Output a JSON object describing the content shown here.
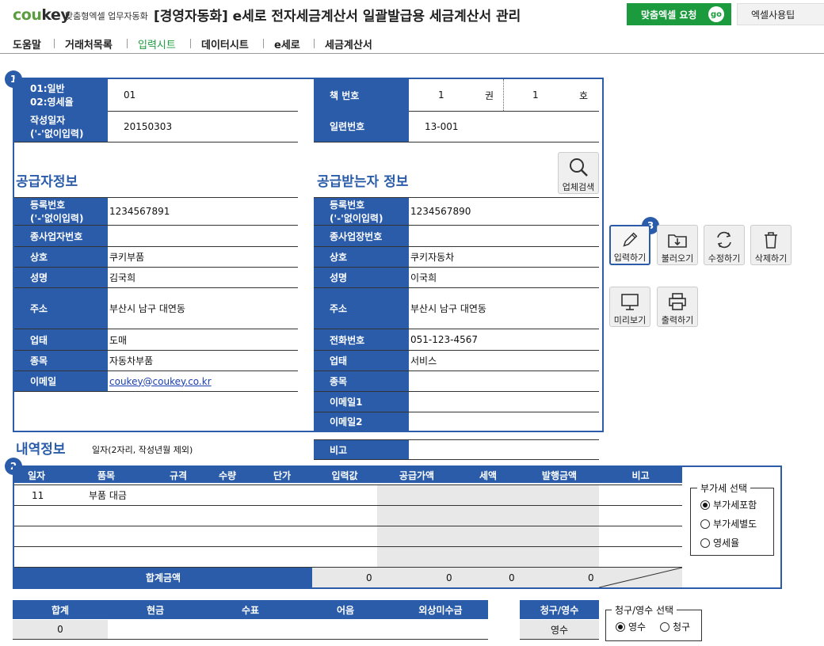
{
  "header": {
    "logo_part1": "cou",
    "logo_part2": "key",
    "logo_subtitle": "맞춤형엑셀 업무자동화",
    "title": "[경영자동화] e세로 전자세금계산서 일괄발급용 세금계산서 관리",
    "request_button": "맞춤엑셀 요청",
    "go_label": "go",
    "tips_button": "엑셀사용팁"
  },
  "menu": [
    "도움말",
    "거래처목록",
    "입력시트",
    "데이터시트",
    "e세로",
    "세금계산서"
  ],
  "menu_active": "입력시트",
  "badges": {
    "one": "1",
    "two": "2",
    "three": "3"
  },
  "top_info": {
    "type_label_1": "01:일반",
    "type_label_2": "02:영세율",
    "type_value": "01",
    "date_label_1": "작성일자",
    "date_label_2": "('-'없이입력)",
    "date_value": "20150303",
    "book_label": "책 번호",
    "book_vol": "1",
    "book_vol_unit": "권",
    "book_no": "1",
    "book_no_unit": "호",
    "serial_label": "일련번호",
    "serial_value": "13-001"
  },
  "supplier": {
    "section_title": "공급자정보",
    "reg_label_1": "등록번호",
    "reg_label_2": "('-'없이입력)",
    "reg_value": "1234567891",
    "subbiz_label": "종사업자번호",
    "subbiz_value": "",
    "company_label": "상호",
    "company_value": "쿠키부품",
    "name_label": "성명",
    "name_value": "김국희",
    "address_label": "주소",
    "address_value": "부산시 남구 대연동",
    "biztype_label": "업태",
    "biztype_value": "도매",
    "item_label": "종목",
    "item_value": "자동차부품",
    "email_label": "이메일",
    "email_value": "coukey@coukey.co.kr"
  },
  "buyer": {
    "section_title": "공급받는자 정보",
    "search_button": "업체검색",
    "reg_label_1": "등록번호",
    "reg_label_2": "('-'없이입력)",
    "reg_value": "1234567890",
    "subbiz_label": "종사업장번호",
    "subbiz_value": "",
    "company_label": "상호",
    "company_value": "쿠키자동차",
    "name_label": "성명",
    "name_value": "이국희",
    "address_label": "주소",
    "address_value": "부산시 남구 대연동",
    "phone_label": "전화번호",
    "phone_value": "051-123-4567",
    "biztype_label": "업태",
    "biztype_value": "서비스",
    "item_label": "종목",
    "item_value": "",
    "email1_label": "이메일1",
    "email1_value": "",
    "email2_label": "이메일2",
    "email2_value": "",
    "note_label": "비고",
    "note_value": ""
  },
  "tools": {
    "input": "입력하기",
    "load": "불러오기",
    "edit": "수정하기",
    "delete": "삭제하기",
    "preview": "미리보기",
    "print": "출력하기"
  },
  "details": {
    "section_title": "내역정보",
    "hint": "일자(2자리, 작성년월 제외)",
    "columns": [
      "일자",
      "품목",
      "규격",
      "수량",
      "단가",
      "입력값",
      "공급가액",
      "세액",
      "발행금액",
      "비고"
    ],
    "rows": [
      {
        "day": "11",
        "item": "부품 대금"
      }
    ],
    "total_label": "합계금액",
    "total_supply": "0",
    "total_tax": "0",
    "total_issue": "0",
    "total_note": "0"
  },
  "vat": {
    "legend": "부가세 선택",
    "options": [
      "부가세포함",
      "부가세별도",
      "영세율"
    ],
    "selected_index": 0
  },
  "summary": {
    "columns": [
      "합계",
      "현금",
      "수표",
      "어음",
      "외상미수금"
    ],
    "total_value": "0",
    "claim_label": "청구/영수",
    "claim_value": "영수"
  },
  "claim_choice": {
    "legend": "청구/영수 선택",
    "options": [
      "영수",
      "청구"
    ],
    "selected_index": 0
  }
}
